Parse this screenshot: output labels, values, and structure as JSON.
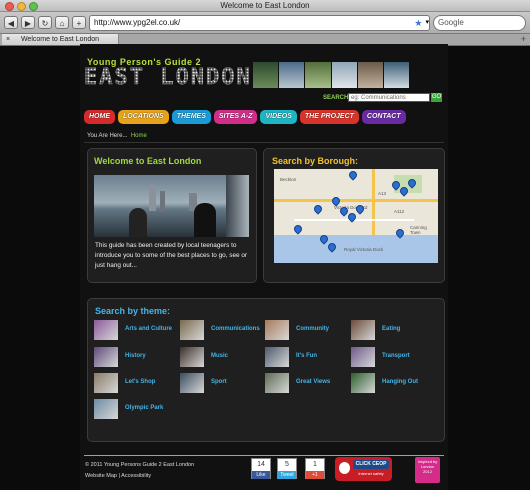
{
  "window": {
    "title": "Welcome to East London"
  },
  "toolbar": {
    "url": "http://www.ypg2el.co.uk/",
    "search_placeholder": "Google",
    "back_icon": "back-arrow-icon",
    "forward_icon": "forward-arrow-icon"
  },
  "tabs": [
    {
      "label": "Welcome to East London"
    }
  ],
  "site": {
    "brand_top": "Young Person's Guide 2",
    "brand_main": "EAST LONDON",
    "search_label": "SEARCH:",
    "search_placeholder": "eg: Communications",
    "go_label": "GO",
    "nav": [
      {
        "label": "HOME",
        "color": "#d42b2b"
      },
      {
        "label": "LOCATIONS",
        "color": "#e6a21a"
      },
      {
        "label": "THEMES",
        "color": "#1a9bd7"
      },
      {
        "label": "SITES A-Z",
        "color": "#d12e8a"
      },
      {
        "label": "VIDEOS",
        "color": "#1fb4c4"
      },
      {
        "label": "THE PROJECT",
        "color": "#d9342b"
      },
      {
        "label": "CONTACT",
        "color": "#6a2aa3"
      }
    ],
    "breadcrumb_prefix": "You Are Here...",
    "breadcrumb_here": "Home"
  },
  "welcome": {
    "title": "Welcome to East London",
    "text": "This guide has been created by local teenagers to introduce you to some of the best places to go, see or just hang out..."
  },
  "borough": {
    "title": "Search by Borough:",
    "map_labels": [
      "Victoria Dock Rd",
      "A13",
      "A112",
      "Canning Town",
      "Royal Victoria Dock",
      "Beckton"
    ]
  },
  "themes": {
    "title": "Search by theme:",
    "items": [
      {
        "label": "Arts and Culture"
      },
      {
        "label": "Communications"
      },
      {
        "label": "Community"
      },
      {
        "label": "Eating"
      },
      {
        "label": "History"
      },
      {
        "label": "Music"
      },
      {
        "label": "It's Fun"
      },
      {
        "label": "Transport"
      },
      {
        "label": "Let's Shop"
      },
      {
        "label": "Sport"
      },
      {
        "label": "Great Views"
      },
      {
        "label": "Hanging Out"
      },
      {
        "label": "Olympic Park"
      }
    ]
  },
  "footer": {
    "copyright": "© 2011 Young Persons Guide 2 East London",
    "links": "Website Map | Accessibility",
    "like_count": "14",
    "like_label": "Like",
    "tweet_count": "5",
    "tweet_label": "Tweet",
    "plus_count": "1",
    "plus_label": "+1",
    "ceop_label": "CLICK CEOP",
    "ceop_sub": "Internet safety",
    "badge_text": "Inspired by London 2012"
  }
}
